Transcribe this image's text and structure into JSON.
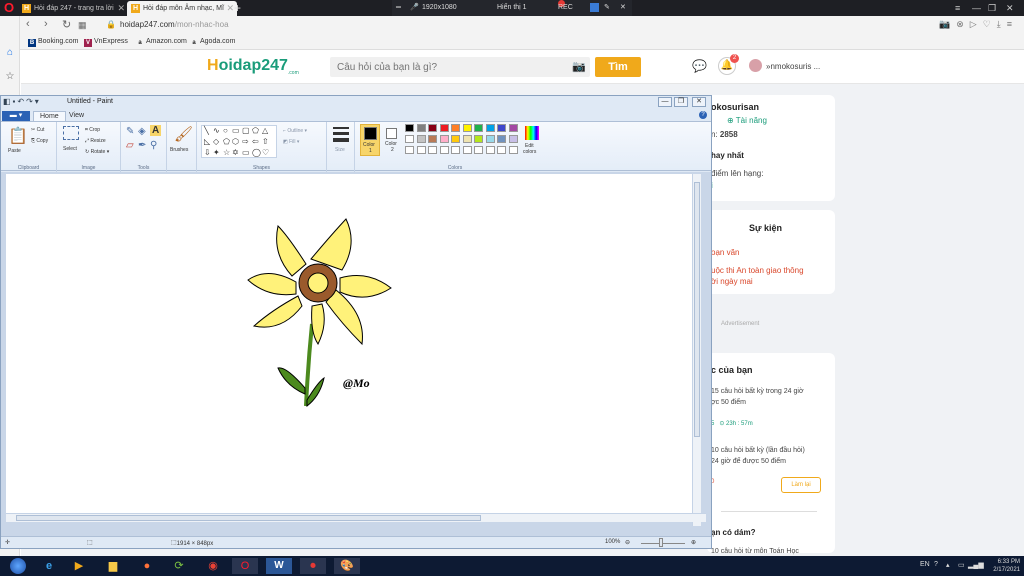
{
  "browser": {
    "tabs": [
      {
        "label": "Hỏi đáp 247 - trang tra lời"
      },
      {
        "label": "Hỏi đáp môn Âm nhạc, Mĩ"
      }
    ],
    "recording": {
      "resolution": "1920x1080",
      "display": "Hiển thị 1",
      "rec": "REC"
    },
    "url_host": "hoidap247.com",
    "url_path": "/mon-nhac-hoa",
    "bookmarks": [
      "Booking.com",
      "VnExpress",
      "Amazon.com",
      "Agoda.com"
    ]
  },
  "site": {
    "logo_h": "H",
    "logo_rest": "oidap247",
    "logo_sub": ".com",
    "search_placeholder": "Câu hỏi của bạn là gì?",
    "search_button": "Tìm",
    "notification_count": "2",
    "username": "»nmokosuris ...",
    "profile": {
      "name": "okosurisan",
      "rank": "Tài năng",
      "points_prefix": "n:",
      "points": "2858",
      "section": "hay nhất",
      "hint": "điểm lên hạng:",
      "hint2": "i"
    },
    "events": {
      "title": "Sự kiện",
      "item1": "oạn văn",
      "item2_line1": "uộc thi An toàn giao thông",
      "item2_line2": "ời ngày mai"
    },
    "advert": "Advertisement",
    "tasks": {
      "title": "c của bạn",
      "t1_line1": "15 câu hỏi  bất kỳ  trong 24 giờ",
      "t1_line2": "ợc 50 điểm",
      "t1_meta_a": "5",
      "t1_meta_b": "23h : 57m",
      "t2_line1": "10 câu hỏi  bất kỳ (lần đầu hỏi)",
      "t2_line2": "24 giờ để được 50 điểm",
      "t2_meta": "0",
      "t2_button": "Làm lại"
    },
    "bottom": {
      "title": "ạn có dám?",
      "line1": "10 câu hỏi  từ môn Toán Học"
    }
  },
  "paint": {
    "title": "Untitled - Paint",
    "file_tab": "",
    "tabs": [
      "Home",
      "View"
    ],
    "groups": {
      "clipboard": "Clipboard",
      "image": "Image",
      "tools": "Tools",
      "shapes": "Shapes",
      "colors": "Colors"
    },
    "labels": {
      "paste": "Paste",
      "cut": "Cut",
      "copy": "Copy",
      "select": "Select",
      "crop": "Crop",
      "resize": "Resize",
      "rotate": "Rotate",
      "brushes": "Brushes",
      "outline": "Outline",
      "fill": "Fill",
      "size": "Size",
      "color1_a": "Color",
      "color1_b": "1",
      "color2_a": "Color",
      "color2_b": "2",
      "edit_a": "Edit",
      "edit_b": "colors"
    },
    "palette": [
      "#000000",
      "#7f7f7f",
      "#880015",
      "#ed1c24",
      "#ff7f27",
      "#fff200",
      "#22b14c",
      "#00a2e8",
      "#3f48cc",
      "#a349a4",
      "#ffffff",
      "#c3c3c3",
      "#b97a57",
      "#ffaec9",
      "#ffc90e",
      "#efe4b0",
      "#b5e61d",
      "#99d9ea",
      "#7092be",
      "#c8bfe7",
      "#ffffff",
      "#ffffff",
      "#ffffff",
      "#ffffff",
      "#ffffff",
      "#ffffff",
      "#ffffff",
      "#ffffff",
      "#ffffff",
      "#ffffff"
    ],
    "drawing": {
      "signature": "@Mo",
      "petal_color": "#fff27a",
      "center_color": "#9a5a2c",
      "stem_color": "#4c8a1e"
    },
    "status": {
      "dimensions": "1914 × 848px",
      "zoom": "100%"
    }
  },
  "taskbar": {
    "time": "6:33 PM",
    "date": "2/17/2021",
    "lang": "EN"
  }
}
